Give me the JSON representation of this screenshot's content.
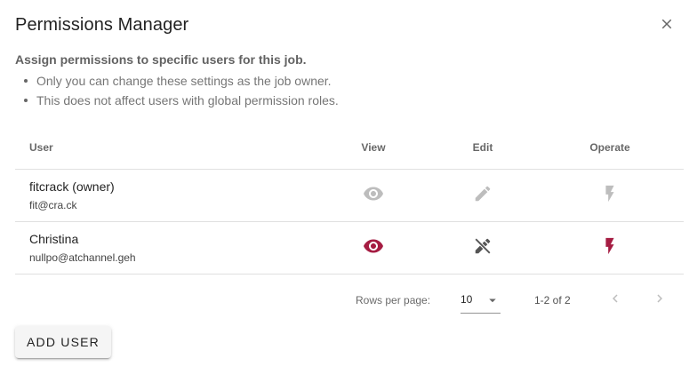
{
  "dialog": {
    "title": "Permissions Manager",
    "close_icon": "close-icon"
  },
  "intro": {
    "heading": "Assign permissions to specific users for this job.",
    "bullets": [
      "Only you can change these settings as the job owner.",
      "This does not affect users with global permission roles."
    ]
  },
  "table": {
    "headers": {
      "user": "User",
      "view": "View",
      "edit": "Edit",
      "operate": "Operate"
    },
    "rows": [
      {
        "name": "fitcrack (owner)",
        "email": "fit@cra.ck",
        "view": {
          "icon": "eye-icon",
          "state": "disabled"
        },
        "edit": {
          "icon": "pencil-icon",
          "state": "disabled"
        },
        "operate": {
          "icon": "flash-icon",
          "state": "disabled"
        }
      },
      {
        "name": "Christina",
        "email": "nullpo@atchannel.geh",
        "view": {
          "icon": "eye-icon",
          "state": "granted"
        },
        "edit": {
          "icon": "pencil-off-icon",
          "state": "denied"
        },
        "operate": {
          "icon": "flash-icon",
          "state": "granted"
        }
      }
    ],
    "footer": {
      "rows_per_page_label": "Rows per page:",
      "rows_per_page_value": "10",
      "range_text": "1-2 of 2",
      "prev_icon": "chevron-left-icon",
      "next_icon": "chevron-right-icon"
    }
  },
  "actions": {
    "add_user_label": "Add user"
  },
  "colors": {
    "granted": "#a51c42",
    "disabled": "#bdbdbd",
    "denied": "#555555"
  }
}
